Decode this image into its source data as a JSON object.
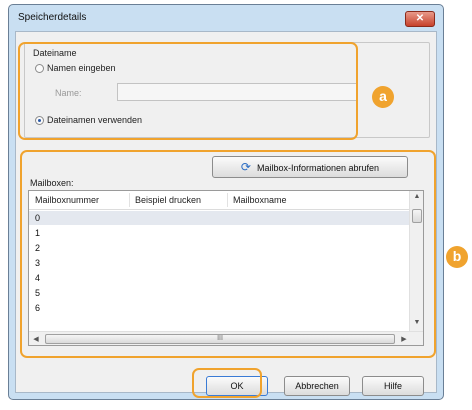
{
  "dialog": {
    "title": "Speicherdetails",
    "close_glyph": "✕"
  },
  "filename_group": {
    "label": "Dateiname",
    "radio_enter_name": "Namen eingeben",
    "name_label": "Name:",
    "name_value": "",
    "radio_use_filename": "Dateinamen verwenden",
    "selected_option": "Dateinamen verwenden"
  },
  "mailbox_section": {
    "label": "Mailboxen:",
    "fetch_button": "Mailbox-Informationen abrufen",
    "columns": [
      "Mailboxnummer",
      "Beispiel drucken",
      "Mailboxname"
    ],
    "rows": [
      "0",
      "1",
      "2",
      "3",
      "4",
      "5",
      "6"
    ],
    "selected_row": "0",
    "hscroll_mark": "III"
  },
  "buttons": {
    "ok": "OK",
    "cancel": "Abbrechen",
    "help": "Hilfe"
  },
  "callouts": {
    "a": "a",
    "b": "b"
  },
  "colors": {
    "callout": "#f0a32e",
    "titlebar": "#c9dff2",
    "close": "#c7412b"
  }
}
